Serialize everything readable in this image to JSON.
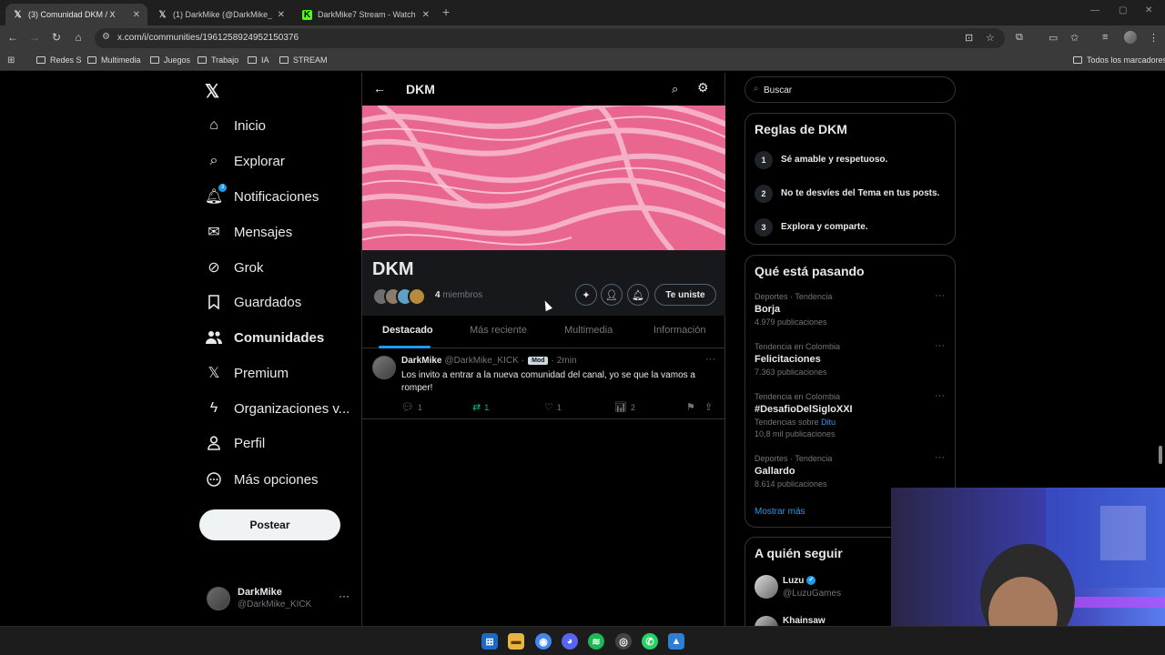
{
  "browser": {
    "tabs": [
      {
        "title": "(3) Comunidad DKM / X",
        "active": true,
        "favicon": "X"
      },
      {
        "title": "(1) DarkMike (@DarkMike_KICK",
        "active": false,
        "favicon": "X"
      },
      {
        "title": "DarkMike7 Stream - Watch Live",
        "active": false,
        "favicon": "K"
      }
    ],
    "url": "x.com/i/communities/1961258924952150376",
    "bookmarks": [
      "Redes S",
      "Multimedia",
      "Juegos",
      "Trabajo",
      "IA",
      "STREAM"
    ],
    "all_bookmarks": "Todos los marcadores"
  },
  "sidebar": {
    "logo": "X",
    "items": [
      {
        "label": "Inicio",
        "icon": "home-icon"
      },
      {
        "label": "Explorar",
        "icon": "search-icon"
      },
      {
        "label": "Notificaciones",
        "icon": "bell-icon",
        "badge": "3"
      },
      {
        "label": "Mensajes",
        "icon": "mail-icon"
      },
      {
        "label": "Grok",
        "icon": "grok-icon"
      },
      {
        "label": "Guardados",
        "icon": "bookmark-icon"
      },
      {
        "label": "Comunidades",
        "icon": "people-icon",
        "active": true
      },
      {
        "label": "Premium",
        "icon": "x-premium-icon"
      },
      {
        "label": "Organizaciones v...",
        "icon": "lightning-icon"
      },
      {
        "label": "Perfil",
        "icon": "person-icon"
      },
      {
        "label": "Más opciones",
        "icon": "more-circle-icon"
      }
    ],
    "post_button": "Postear",
    "account": {
      "name": "DarkMike",
      "handle": "@DarkMike_KICK"
    }
  },
  "community": {
    "header_title": "DKM",
    "name": "DKM",
    "member_count": "4",
    "member_label": "miembros",
    "joined_button": "Te uniste",
    "tabs": [
      "Destacado",
      "Más reciente",
      "Multimedia",
      "Información"
    ],
    "active_tab": "Destacado",
    "post": {
      "name": "DarkMike",
      "handle": "@DarkMike_KICK",
      "separator": "·",
      "badge": "Mod",
      "time": "2min",
      "text": "Los invito a entrar a la nueva comunidad del canal, yo se que la vamos a romper!",
      "replies": "1",
      "reposts": "1",
      "likes": "1",
      "views": "2"
    }
  },
  "right": {
    "search_placeholder": "Buscar",
    "rules_title": "Reglas de DKM",
    "rules": [
      {
        "num": "1",
        "text": "Sé amable y respetuoso."
      },
      {
        "num": "2",
        "text": "No te desvíes del Tema en tus posts."
      },
      {
        "num": "3",
        "text": "Explora y comparte."
      }
    ],
    "trends_title": "Qué está pasando",
    "trends": [
      {
        "category": "Deportes · Tendencia",
        "name": "Borja",
        "meta": "4.979 publicaciones"
      },
      {
        "category": "Tendencia en Colombia",
        "name": "Felicitaciones",
        "meta": "7.363 publicaciones"
      },
      {
        "category": "Tendencia en Colombia",
        "name": "#DesafioDelSigloXXI",
        "topics_prefix": "Tendencias sobre",
        "topics_link": "Ditu",
        "meta": "10,8 mil publicaciones"
      },
      {
        "category": "Deportes · Tendencia",
        "name": "Gallardo",
        "meta": "8.614 publicaciones"
      }
    ],
    "show_more": "Mostrar más",
    "follow_title": "A quién seguir",
    "follow": [
      {
        "name": "Luzu",
        "handle": "@LuzuGames",
        "verified": true
      },
      {
        "name": "Khainsaw",
        "handle": "",
        "verified": false
      }
    ]
  },
  "colors": {
    "accent": "#1d9bf0",
    "repost_green": "#00ba7c",
    "background": "#000000",
    "border": "#2f3336",
    "banner_pink": "#e66a93"
  }
}
